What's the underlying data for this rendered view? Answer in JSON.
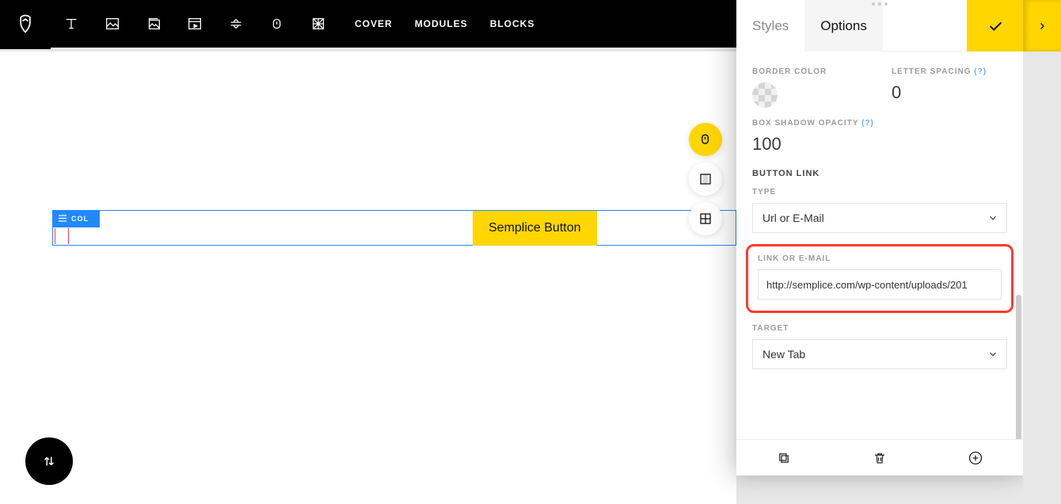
{
  "toolbar": {
    "icons": [
      "text-icon",
      "image-icon",
      "gallery-icon",
      "video-icon",
      "divider-icon",
      "button-icon",
      "pattern-icon"
    ],
    "menu": {
      "cover": "COVER",
      "modules": "MODULES",
      "blocks": "BLOCKS"
    }
  },
  "canvas": {
    "col_label": "COL",
    "button_text": "Semplice Button"
  },
  "panel": {
    "tabs": {
      "styles": "Styles",
      "options": "Options"
    },
    "border_color": {
      "label": "BORDER COLOR"
    },
    "letter_spacing": {
      "label": "LETTER SPACING",
      "help": "(?)",
      "value": "0"
    },
    "box_shadow": {
      "label": "BOX SHADOW OPACITY",
      "help": "(?)",
      "value": "100"
    },
    "button_link_title": "BUTTON LINK",
    "type": {
      "label": "TYPE",
      "value": "Url or E-Mail"
    },
    "link": {
      "label": "LINK OR E-MAIL",
      "value": "http://semplice.com/wp-content/uploads/201"
    },
    "target": {
      "label": "TARGET",
      "value": "New Tab"
    }
  }
}
